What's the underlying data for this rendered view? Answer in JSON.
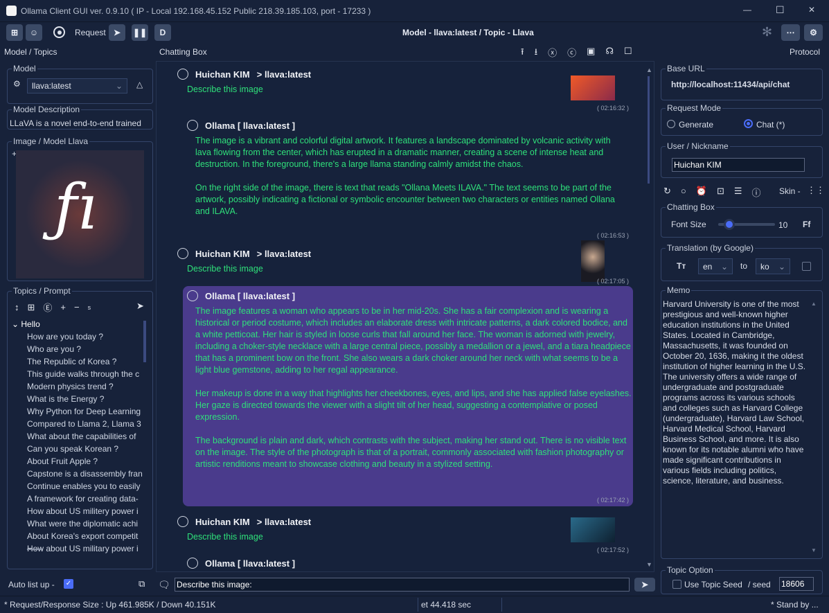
{
  "window": {
    "title": "Ollama Client GUI  ver. 0.9.10   ( IP - Local 192.168.45.152  Public 218.39.185.103,  port - 17233 )",
    "controls": [
      "—",
      "☐",
      "✕"
    ]
  },
  "toolbar": {
    "request_label": "Request",
    "center_title": "Model - llava:latest / Topic - Llava"
  },
  "sections": {
    "left": "Model / Topics",
    "center": "Chatting Box",
    "right": "Protocol"
  },
  "model": {
    "label": "Model",
    "selected": "llava:latest",
    "desc_label": "Model Description",
    "description": "LLaVA is a novel end-to-end trained",
    "image_label": "Image / Model Llava"
  },
  "topics": {
    "label": "Topics / Prompt",
    "s_label": "s",
    "root": "Hello",
    "items": [
      "How are you today ?",
      "Who are you ?",
      "The Republic of Korea ?",
      "This guide walks through the c",
      "Modern physics trend ?",
      "What is the Energy ?",
      "Why Python for Deep Learning",
      "Compared to Llama 2, Llama 3",
      "What about the capabilities of",
      "Can you speak Korean ?",
      "About Fruit Apple ?",
      "Capstone is a disassembly fran",
      "Continue enables you to easily",
      "A framework for creating data-",
      "How about US militery power i",
      "What were the diplomatic achi",
      "About Korea's export competit",
      "How about US military power i"
    ]
  },
  "auto_list": {
    "label": "Auto list up  -",
    "checked": true
  },
  "chat": {
    "messages": [
      {
        "type": "user",
        "name": "Huichan KIM",
        "target": "> llava:latest",
        "text": "Describe this image",
        "time": "( 02:16:32 )"
      },
      {
        "type": "bot",
        "name": "Ollama [ llava:latest ]",
        "paragraphs": [
          "The image is a vibrant and colorful digital artwork. It features a landscape dominated by volcanic activity with lava flowing from the center, which has erupted in a dramatic manner, creating a scene of intense heat and destruction. In the foreground, there's a large llama standing calmly amidst the chaos.",
          "On the right side of the image, there is text that reads \"Ollana Meets ILAVA.\" The text seems to be part of the artwork, possibly indicating a fictional or symbolic encounter between two characters or entities named Ollana and ILAVA."
        ],
        "time": "( 02:16:53 )"
      },
      {
        "type": "user",
        "name": "Huichan KIM",
        "target": "> llava:latest",
        "text": "Describe this image",
        "time": "( 02:17:05 )"
      },
      {
        "type": "bot",
        "name": "Ollama [ llava:latest ]",
        "paragraphs": [
          "The image features a woman who appears to be in her mid-20s. She has a fair complexion and is wearing a historical or period costume, which includes an elaborate dress with intricate patterns, a dark colored bodice, and a white petticoat. Her hair is styled in loose curls that fall around her face. The woman is adorned with jewelry, including a choker-style necklace with a large central piece, possibly a medallion or a jewel, and a tiara headpiece that has a prominent bow on the front. She also wears a dark choker around her neck with what seems to be a light blue gemstone, adding to her regal appearance.",
          "Her makeup is done in a way that highlights her cheekbones, eyes, and lips, and she has applied false eyelashes. Her gaze is directed towards the viewer with a slight tilt of her head, suggesting a contemplative or posed expression.",
          "The background is plain and dark, which contrasts with the subject, making her stand out. There is no visible text on the image. The style of the photograph is that of a portrait, commonly associated with fashion photography or artistic renditions meant to showcase clothing and beauty in a stylized setting."
        ],
        "time": "( 02:17:42 )"
      },
      {
        "type": "user",
        "name": "Huichan KIM",
        "target": "> llava:latest",
        "text": "Describe this image",
        "time": "( 02:17:52 )"
      },
      {
        "type": "bot",
        "name": "Ollama [ llava:latest ]"
      }
    ],
    "input_value": "Describe this image:"
  },
  "right": {
    "base_url_label": "Base URL",
    "base_url": "http://localhost:11434/api/chat",
    "mode_label": "Request Mode",
    "mode_generate": "Generate",
    "mode_chat": "Chat (*)",
    "mode_selected": "chat",
    "user_label": "User / Nickname",
    "user": "Huichan KIM",
    "skin_label": "Skin -",
    "chat_box_label": "Chatting Box",
    "font_size_label": "Font Size",
    "font_size": 10,
    "ff_label": "Ff",
    "translation_label": "Translation (by Google)",
    "from": "en",
    "to_label": "to",
    "to": "ko",
    "memo_label": "Memo",
    "memo": "Harvard University is one of the most prestigious and well-known higher education institutions in the United States. Located in Cambridge, Massachusetts, it was founded on October 20, 1636, making it the oldest institution of higher learning in the U.S. The university offers a wide range of undergraduate and postgraduate programs across its various schools and colleges such as Harvard College (undergraduate), Harvard Law School, Harvard Medical School, Harvard Business School, and more. It is also known for its notable alumni who have made significant contributions in various fields including politics, science, literature, and business.",
    "topic_option_label": "Topic Option",
    "topic_seed_label": "Use Topic Seed",
    "seed_label": "/ seed",
    "seed": "18606"
  },
  "status": {
    "size": "* Request/Response Size : Up 461.985K / Down 40.151K",
    "elapsed": "et 44.418 sec",
    "state": "* Stand by ..."
  },
  "colors": {
    "bg": "#17223a",
    "accent": "#4a6cf7",
    "bot_highlight": "#4a3b8c",
    "message_text": "#2fe07a"
  }
}
